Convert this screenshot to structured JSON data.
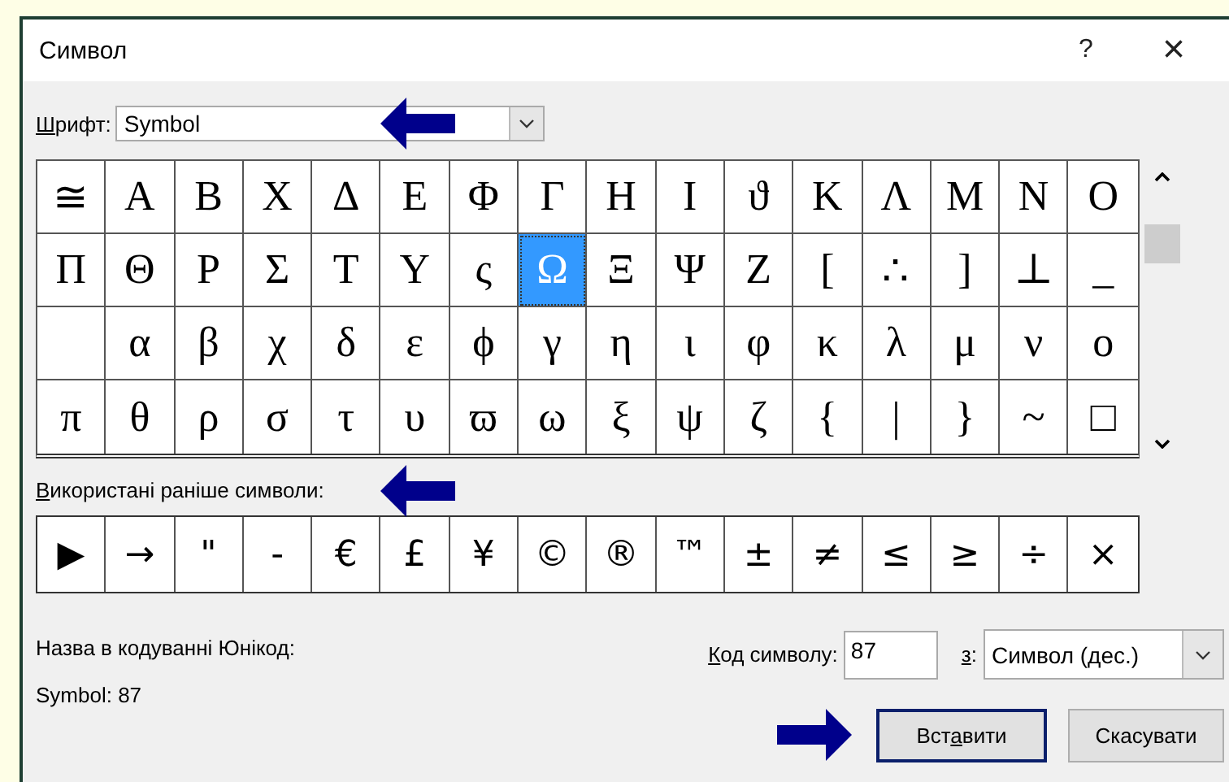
{
  "window": {
    "title": "Символ",
    "help": "?",
    "close": "×"
  },
  "font": {
    "label": {
      "key": "Ш",
      "after": "рифт:"
    },
    "value": "Symbol"
  },
  "symbols": [
    {
      "symbol": "≅",
      "selected": false
    },
    {
      "symbol": "Α",
      "selected": false
    },
    {
      "symbol": "Β",
      "selected": false
    },
    {
      "symbol": "Χ",
      "selected": false
    },
    {
      "symbol": "Δ",
      "selected": false
    },
    {
      "symbol": "Ε",
      "selected": false
    },
    {
      "symbol": "Φ",
      "selected": false
    },
    {
      "symbol": "Γ",
      "selected": false
    },
    {
      "symbol": "Η",
      "selected": false
    },
    {
      "symbol": "Ι",
      "selected": false
    },
    {
      "symbol": "ϑ",
      "selected": false
    },
    {
      "symbol": "Κ",
      "selected": false
    },
    {
      "symbol": "Λ",
      "selected": false
    },
    {
      "symbol": "Μ",
      "selected": false
    },
    {
      "symbol": "Ν",
      "selected": false
    },
    {
      "symbol": "Ο",
      "selected": false
    },
    {
      "symbol": "Π",
      "selected": false
    },
    {
      "symbol": "Θ",
      "selected": false
    },
    {
      "symbol": "Ρ",
      "selected": false
    },
    {
      "symbol": "Σ",
      "selected": false
    },
    {
      "symbol": "Τ",
      "selected": false
    },
    {
      "symbol": "Υ",
      "selected": false
    },
    {
      "symbol": "ς",
      "selected": false
    },
    {
      "symbol": "Ω",
      "selected": true
    },
    {
      "symbol": "Ξ",
      "selected": false
    },
    {
      "symbol": "Ψ",
      "selected": false
    },
    {
      "symbol": "Ζ",
      "selected": false
    },
    {
      "symbol": "[",
      "selected": false
    },
    {
      "symbol": "∴",
      "selected": false
    },
    {
      "symbol": "]",
      "selected": false
    },
    {
      "symbol": "⊥",
      "selected": false
    },
    {
      "symbol": "_",
      "selected": false
    },
    {
      "selected": false
    },
    {
      "symbol": "α",
      "selected": false
    },
    {
      "symbol": "β",
      "selected": false
    },
    {
      "symbol": "χ",
      "selected": false
    },
    {
      "symbol": "δ",
      "selected": false
    },
    {
      "symbol": "ε",
      "selected": false
    },
    {
      "symbol": "ϕ",
      "selected": false
    },
    {
      "symbol": "γ",
      "selected": false
    },
    {
      "symbol": "η",
      "selected": false
    },
    {
      "symbol": "ι",
      "selected": false
    },
    {
      "symbol": "φ",
      "selected": false
    },
    {
      "symbol": "κ",
      "selected": false
    },
    {
      "symbol": "λ",
      "selected": false
    },
    {
      "symbol": "μ",
      "selected": false
    },
    {
      "symbol": "ν",
      "selected": false
    },
    {
      "symbol": "ο",
      "selected": false
    },
    {
      "symbol": "π",
      "selected": false
    },
    {
      "symbol": "θ",
      "selected": false
    },
    {
      "symbol": "ρ",
      "selected": false
    },
    {
      "symbol": "σ",
      "selected": false
    },
    {
      "symbol": "τ",
      "selected": false
    },
    {
      "symbol": "υ",
      "selected": false
    },
    {
      "symbol": "ϖ",
      "selected": false
    },
    {
      "symbol": "ω",
      "selected": false
    },
    {
      "symbol": "ξ",
      "selected": false
    },
    {
      "symbol": "ψ",
      "selected": false
    },
    {
      "symbol": "ζ",
      "selected": false
    },
    {
      "symbol": "{",
      "selected": false
    },
    {
      "symbol": "|",
      "selected": false
    },
    {
      "symbol": "}",
      "selected": false
    },
    {
      "symbol": "~",
      "selected": false
    },
    {
      "symbol": "□",
      "selected": false
    }
  ],
  "recent_label": {
    "key": "В",
    "after": "икористані раніше символи:"
  },
  "recent": [
    "▶",
    "→",
    "\"",
    "-",
    "€",
    "£",
    "¥",
    "©",
    "®",
    "™",
    "±",
    "≠",
    "≤",
    "≥",
    "÷",
    "×"
  ],
  "unicode_name_label": "Назва в кодуванні Юнікод:",
  "unicode_name": "Symbol: 87",
  "code": {
    "label": {
      "key": "К",
      "after": "од символу:"
    },
    "value": "87"
  },
  "from": {
    "label": {
      "key": "з",
      "after": ":"
    },
    "value": "Символ (дес.)"
  },
  "buttons": [
    {
      "label": {
        "before": "Вст",
        "key": "а",
        "after": "вити"
      },
      "default": true
    },
    {
      "label": {
        "after": "Скасувати"
      },
      "default": false
    }
  ],
  "annotations": [
    {
      "kind": "left-arrow"
    },
    {
      "kind": "left-arrow"
    },
    {
      "kind": "right-arrow"
    }
  ]
}
